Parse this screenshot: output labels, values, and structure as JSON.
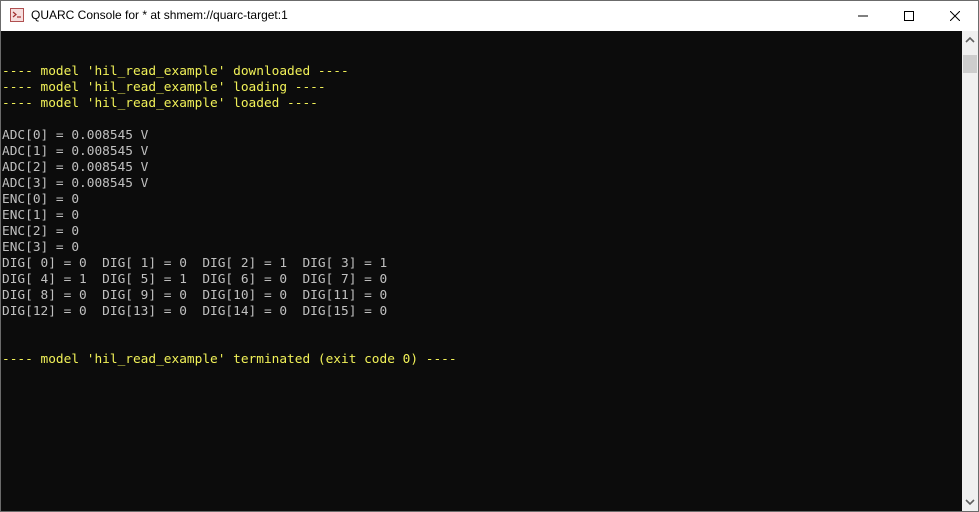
{
  "window": {
    "title": "QUARC Console for * at shmem://quarc-target:1",
    "icon": "console-icon",
    "controls": {
      "minimize": "minimize-icon",
      "maximize": "maximize-icon",
      "close": "close-icon"
    }
  },
  "console": {
    "lines": [
      {
        "text": "",
        "color": "gray"
      },
      {
        "text": "---- model 'hil_read_example' downloaded ----",
        "color": "yellow"
      },
      {
        "text": "---- model 'hil_read_example' loading ----",
        "color": "yellow"
      },
      {
        "text": "---- model 'hil_read_example' loaded ----",
        "color": "yellow"
      },
      {
        "text": "",
        "color": "gray"
      },
      {
        "text": "ADC[0] = 0.008545 V",
        "color": "gray"
      },
      {
        "text": "ADC[1] = 0.008545 V",
        "color": "gray"
      },
      {
        "text": "ADC[2] = 0.008545 V",
        "color": "gray"
      },
      {
        "text": "ADC[3] = 0.008545 V",
        "color": "gray"
      },
      {
        "text": "ENC[0] = 0",
        "color": "gray"
      },
      {
        "text": "ENC[1] = 0",
        "color": "gray"
      },
      {
        "text": "ENC[2] = 0",
        "color": "gray"
      },
      {
        "text": "ENC[3] = 0",
        "color": "gray"
      },
      {
        "text": "DIG[ 0] = 0  DIG[ 1] = 0  DIG[ 2] = 1  DIG[ 3] = 1",
        "color": "gray"
      },
      {
        "text": "DIG[ 4] = 1  DIG[ 5] = 1  DIG[ 6] = 0  DIG[ 7] = 0",
        "color": "gray"
      },
      {
        "text": "DIG[ 8] = 0  DIG[ 9] = 0  DIG[10] = 0  DIG[11] = 0",
        "color": "gray"
      },
      {
        "text": "DIG[12] = 0  DIG[13] = 0  DIG[14] = 0  DIG[15] = 0",
        "color": "gray"
      },
      {
        "text": "",
        "color": "gray"
      },
      {
        "text": "",
        "color": "gray"
      },
      {
        "text": "---- model 'hil_read_example' terminated (exit code 0) ----",
        "color": "yellow"
      }
    ]
  },
  "colors": {
    "yellow": "#f1f158",
    "gray": "#c0c0c0",
    "background": "#0c0c0c"
  }
}
